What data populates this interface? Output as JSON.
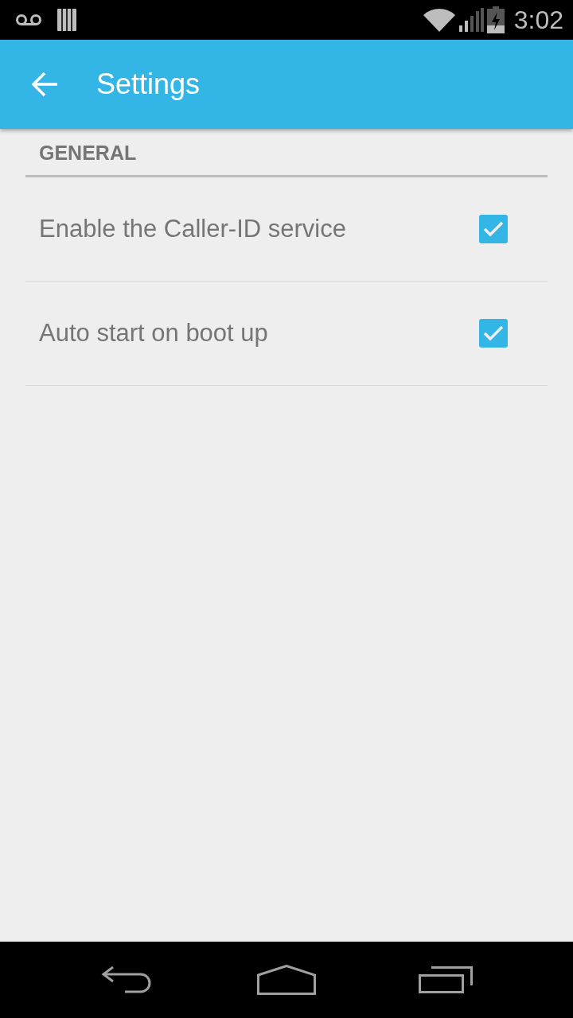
{
  "status_bar": {
    "time": "3:02"
  },
  "app_bar": {
    "title": "Settings"
  },
  "sections": [
    {
      "header": "GENERAL",
      "items": [
        {
          "kind": "checkbox",
          "label": "Enable the Caller-ID service",
          "checked": true
        },
        {
          "kind": "checkbox",
          "label": "Auto start on boot up",
          "checked": true
        }
      ]
    }
  ]
}
